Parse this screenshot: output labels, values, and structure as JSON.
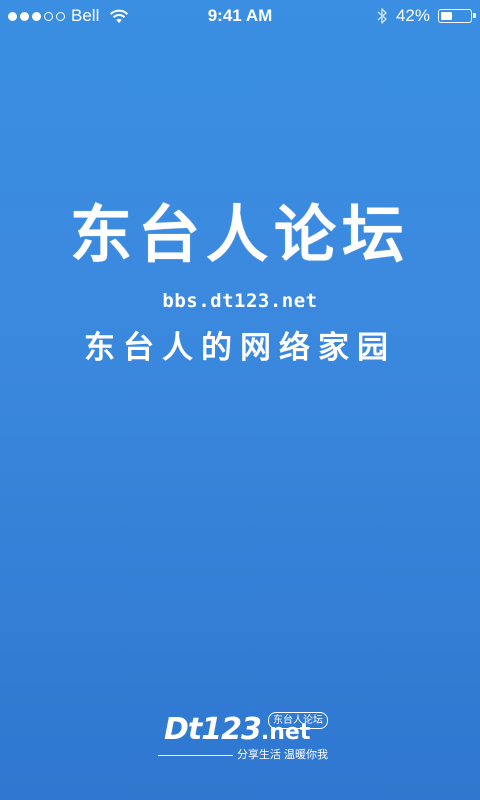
{
  "status_bar": {
    "carrier": "Bell",
    "signal_filled": 3,
    "signal_total": 5,
    "time": "9:41 AM",
    "battery_text": "42%",
    "battery_level": 0.42,
    "icons": [
      "signal-dots-icon",
      "wifi-icon",
      "bluetooth-icon",
      "battery-icon"
    ]
  },
  "splash": {
    "title": "东台人论坛",
    "url": "bbs.dt123.net",
    "slogan": "东台人的网络家园"
  },
  "footer_logo": {
    "wordmark": "Dt123",
    "wordmark_suffix": ".net",
    "badge": "东台人论坛",
    "tagline": "分享生活 温暖你我"
  },
  "colors": {
    "background_top": "#3a8fe2",
    "background_bottom": "#2f77d0",
    "foreground": "#ffffff"
  }
}
